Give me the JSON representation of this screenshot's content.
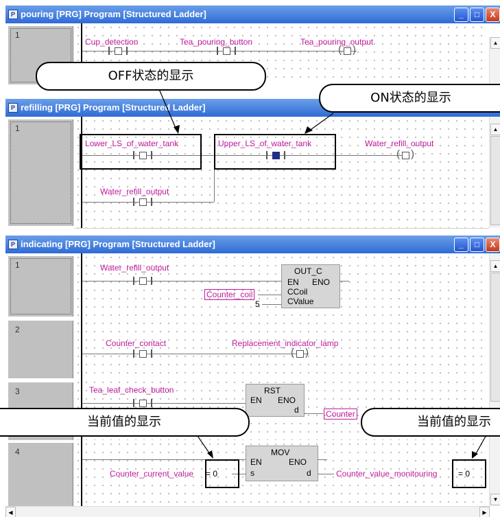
{
  "windows": {
    "pouring": {
      "title": "pouring [PRG] Program [Structured Ladder]",
      "row": "1"
    },
    "refilling": {
      "title": "refilling [PRG] Program [Structured Ladder]",
      "row": "1"
    },
    "indicating": {
      "title": "indicating [PRG] Program [Structured Ladder]",
      "rows": [
        "1",
        "2",
        "3",
        "4"
      ]
    }
  },
  "icons": {
    "window_icon": "program-icon",
    "minimize": "_",
    "maximize": "□",
    "close": "X",
    "up": "▲",
    "down": "▼",
    "left": "◀",
    "right": "▶"
  },
  "pouring": {
    "cup_detection": "Cup_detection",
    "tea_pouring_button": "Tea_pouring_button",
    "tea_pouring_output": "Tea_pouring_output"
  },
  "refilling": {
    "lower_ls": "Lower_LS_of_water_tank",
    "upper_ls": "Upper_LS_of_water_tank",
    "water_refill_output": "Water_refill_output",
    "water_refill_output_contact": "Water_refill_output"
  },
  "indicating": {
    "r1_contact": "Water_refill_output",
    "out_c": {
      "name": "OUT_C",
      "en": "EN",
      "eno": "ENO",
      "ccoil": "CCoil",
      "cvalue": "CValue",
      "coil_var": "Counter_coil",
      "value": "5"
    },
    "r2_contact": "Counter_contact",
    "r2_coil": "Replacement_indicator_lamp",
    "r3_contact": "Tea_leaf_check_button",
    "rst": {
      "name": "RST",
      "en": "EN",
      "eno": "ENO",
      "d": "d",
      "target": "Counter"
    },
    "mov": {
      "name": "MOV",
      "en": "EN",
      "eno": "ENO",
      "s": "s",
      "d": "d"
    },
    "r4_input": "Counter_current_value",
    "r4_input_value": "= 0",
    "r4_output": "Counter_value_monitouring",
    "r4_output_value": "= 0"
  },
  "callouts": {
    "off_state": "OFF状态的显示",
    "on_state": "ON状态的显示",
    "current_value_left": "当前值的显示",
    "current_value_right": "当前值的显示"
  },
  "colors": {
    "title_bar": "#2f6bd6",
    "variable_text": "#c0189a",
    "on_contact": "#1f2e86"
  }
}
